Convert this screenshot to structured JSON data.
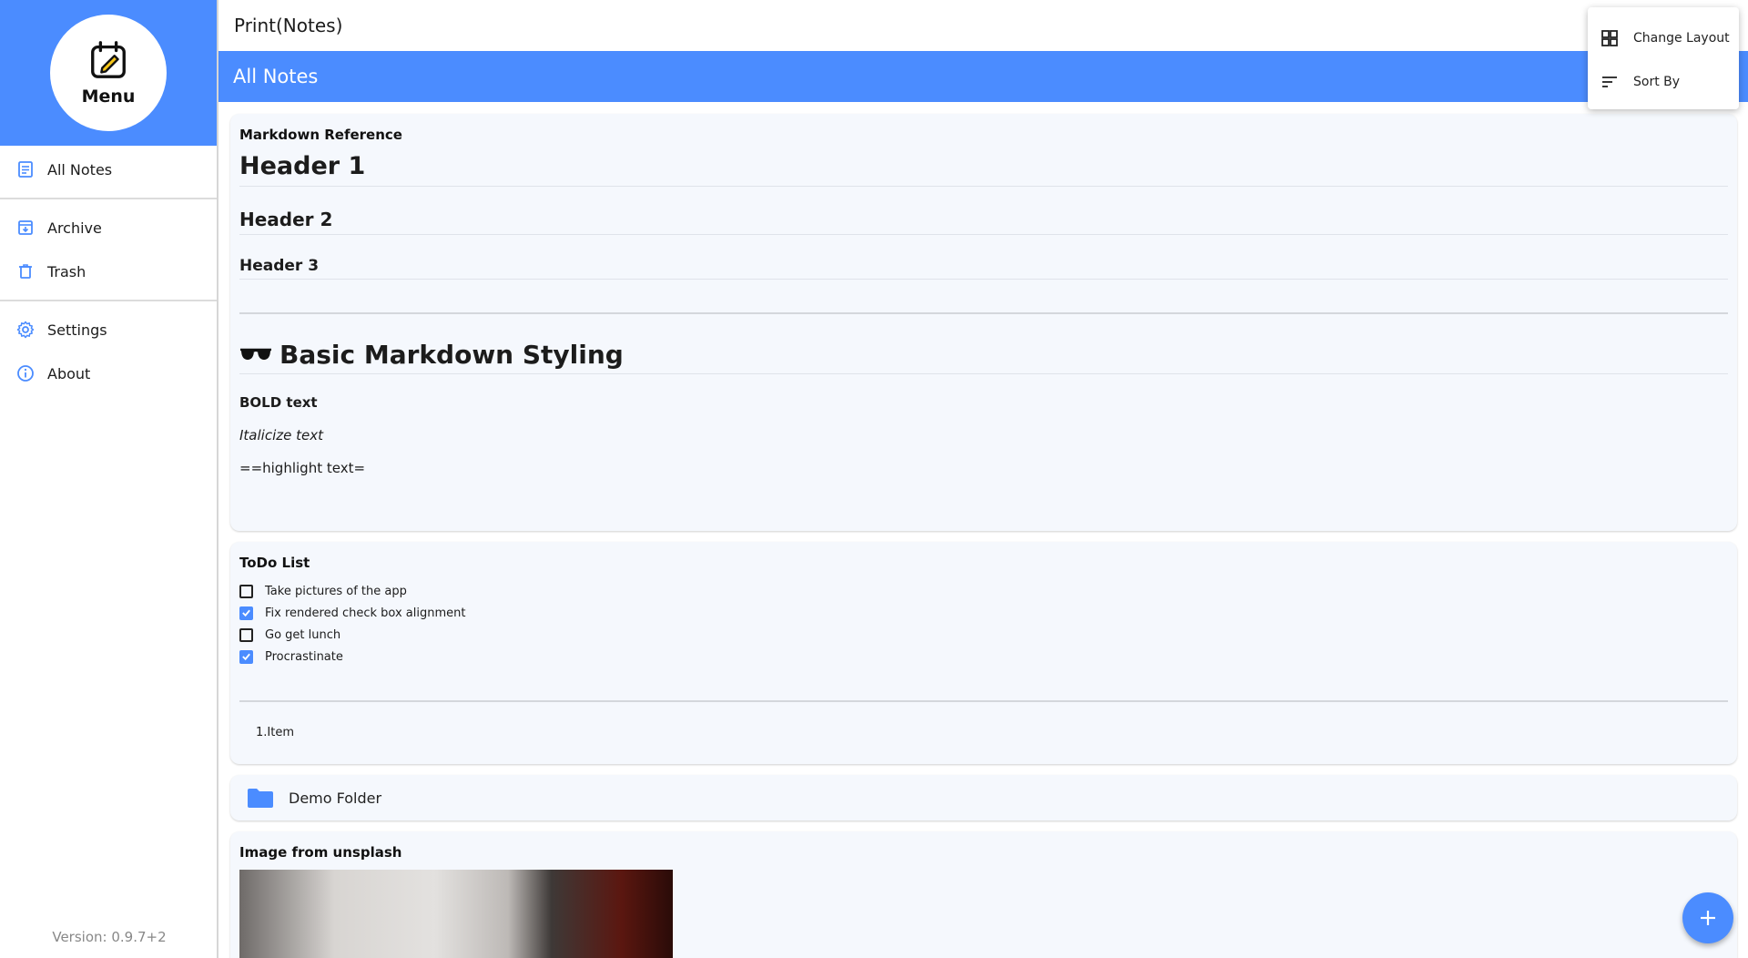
{
  "app": {
    "title": "Print(Notes)"
  },
  "sidebar": {
    "menu_label": "Menu",
    "items": [
      {
        "label": "All Notes",
        "icon": "note-icon"
      },
      {
        "label": "Archive",
        "icon": "archive-icon"
      },
      {
        "label": "Trash",
        "icon": "trash-icon"
      },
      {
        "label": "Settings",
        "icon": "gear-icon"
      },
      {
        "label": "About",
        "icon": "info-icon"
      }
    ],
    "version": "Version: 0.9.7+2"
  },
  "section": {
    "title": "All Notes"
  },
  "popup_menu": {
    "items": [
      {
        "label": "Change Layout",
        "icon": "grid-icon"
      },
      {
        "label": "Sort By",
        "icon": "sort-icon"
      }
    ]
  },
  "notes": {
    "markdown": {
      "title": "Markdown Reference",
      "h1": "Header 1",
      "h2": "Header 2",
      "h3": "Header 3",
      "big_heading": "Basic Markdown Styling",
      "big_heading_emoji": "sunglasses-emoji",
      "bold": "BOLD text",
      "italic": "Italicize text",
      "highlight": "==highlight text="
    },
    "todo": {
      "title": "ToDo List",
      "items": [
        {
          "label": "Take pictures of the app",
          "checked": false
        },
        {
          "label": "Fix rendered check box alignment",
          "checked": true
        },
        {
          "label": "Go get lunch",
          "checked": false
        },
        {
          "label": "Procrastinate",
          "checked": true
        }
      ],
      "ordered_item": "1.Item"
    },
    "folder": {
      "label": "Demo Folder",
      "icon": "folder-icon"
    },
    "image_note": {
      "title": "Image from unsplash"
    }
  },
  "colors": {
    "accent": "#4b8cff",
    "card_bg": "#f5f8fd"
  }
}
